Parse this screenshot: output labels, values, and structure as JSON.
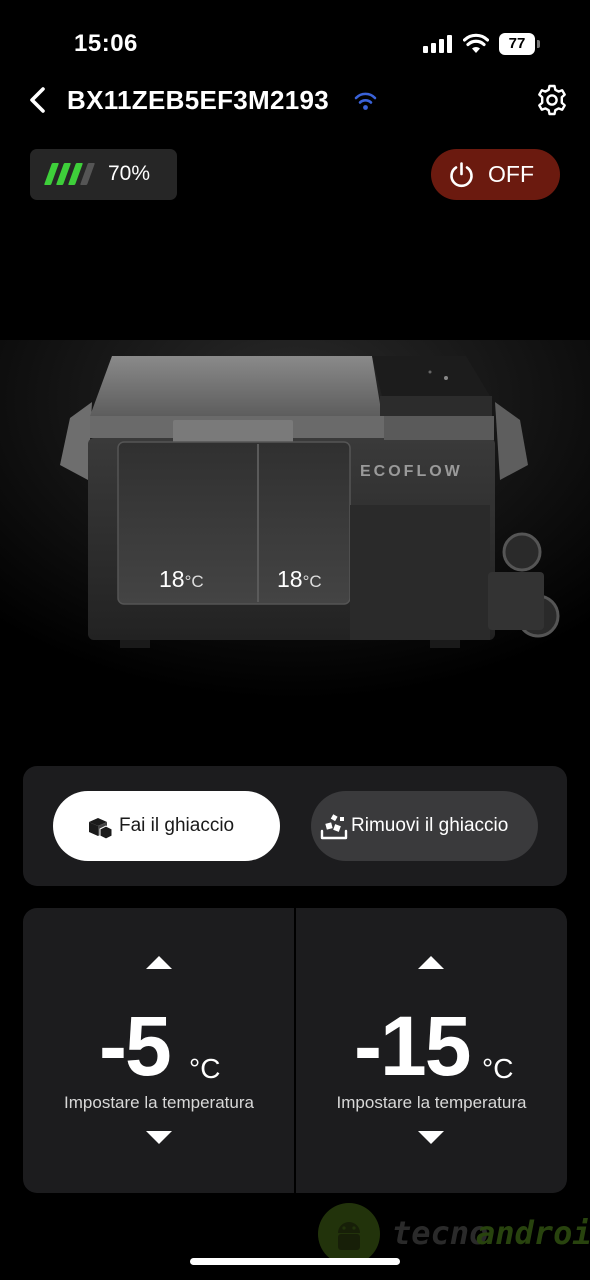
{
  "status_bar": {
    "time": "15:06",
    "battery_level": "77"
  },
  "header": {
    "device_name": "BX11ZEB5EF3M2193",
    "wifi_icon_color": "#3a62d8"
  },
  "battery": {
    "percent_label": "70%",
    "level_fraction": 0.7,
    "bar_color": "#3ecf3a"
  },
  "power": {
    "label": "OFF",
    "color": "#6b1a0f"
  },
  "fridge": {
    "brand": "ECOFLOW",
    "left_zone_temp": "18",
    "right_zone_temp": "18",
    "unit": "°C"
  },
  "ice": {
    "make_label": "Fai il ghiaccio",
    "remove_label": "Rimuovi il ghiaccio"
  },
  "zones": [
    {
      "value": "-5",
      "unit": "°C",
      "caption": "Impostare la temperatura"
    },
    {
      "value": "-15",
      "unit": "°C",
      "caption": "Impostare la temperatura"
    }
  ],
  "watermark": {
    "part1": "tecno",
    "part2": "android"
  }
}
